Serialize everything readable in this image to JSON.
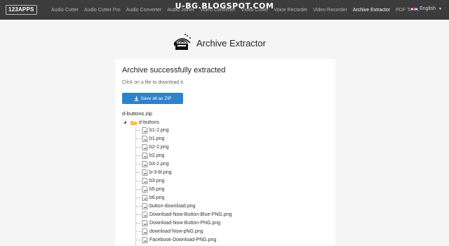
{
  "brand": "123APPS",
  "nav": {
    "items": [
      "Audio Cutter",
      "Audio Cutter Pro",
      "Audio Converter",
      "Audio Joiner",
      "Video Converter",
      "Video Cutter",
      "Voice Recorder",
      "Video Recorder",
      "Archive Extractor",
      "PDF Tools"
    ],
    "active_index": 8
  },
  "language": "English",
  "watermark": "U-BG.BLOGSPOT.COM",
  "app": {
    "title": "Archive Extractor"
  },
  "panel": {
    "title": "Archive successfully extracted",
    "subtitle": "Click on a file to download it.",
    "save_button": "Save all as ZIP"
  },
  "archive": {
    "name": "d-buttons.zip",
    "folder": "d-buttons",
    "files": [
      "b1-2.png",
      "b1.png",
      "b2-2.png",
      "b2.png",
      "b3-2.png",
      "b-3-bl.png",
      "b3.png",
      "b5.png",
      "b6.png",
      "button-download.png",
      "Download-Now-Button-Blue-PNG.png",
      "Download-Now-Button-PNG.png",
      "download-Now-pNG.png",
      "Facebook-Download-PNG.png"
    ]
  },
  "colors": {
    "topbar": "#3c3c3c",
    "accent": "#2e82cd",
    "folder": "#f2c24b"
  }
}
